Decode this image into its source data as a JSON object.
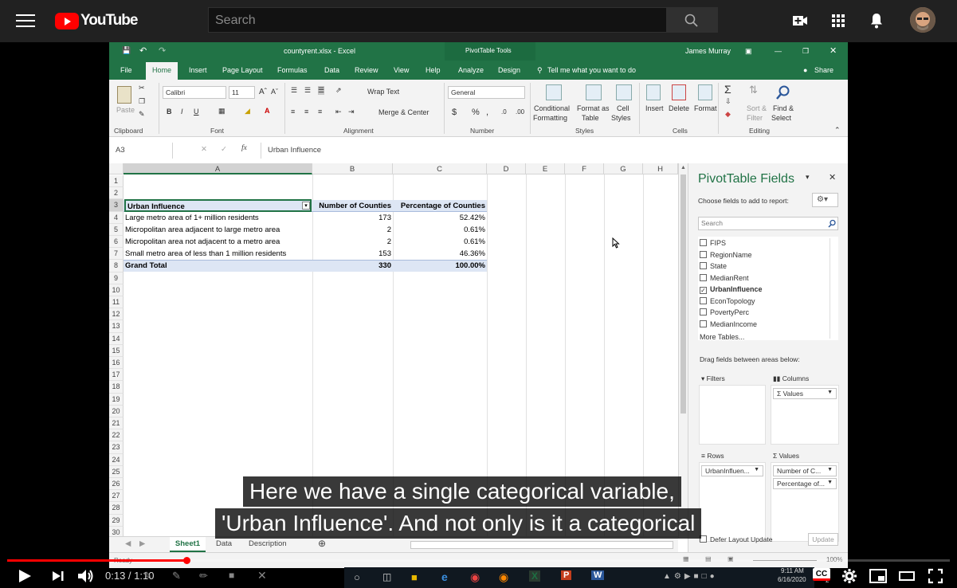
{
  "youtube": {
    "logo_text": "YouTube",
    "search_placeholder": "Search"
  },
  "excel": {
    "filename": "countyrent.xlsx  -  Excel",
    "pivot_tools": "PivotTable Tools",
    "user": "James Murray",
    "tabs": [
      "File",
      "Home",
      "Insert",
      "Page Layout",
      "Formulas",
      "Data",
      "Review",
      "View",
      "Help",
      "Analyze",
      "Design"
    ],
    "tell_me": "Tell me what you want to do",
    "share": "Share",
    "ribbon": {
      "paste": "Paste",
      "font_name": "Calibri",
      "font_size": "11",
      "wrap_text": "Wrap Text",
      "merge_center": "Merge & Center",
      "number_format": "General",
      "conditional": "Conditional",
      "formatting": "Formatting",
      "format_as": "Format as",
      "table": "Table",
      "cell": "Cell",
      "styles": "Styles",
      "insert": "Insert",
      "delete": "Delete",
      "format": "Format",
      "sort_filter": "Sort &",
      "filter": "Filter",
      "find_select": "Find &",
      "select": "Select",
      "groups": [
        "Clipboard",
        "Font",
        "Alignment",
        "Number",
        "Styles",
        "Cells",
        "Editing"
      ]
    },
    "name_box": "A3",
    "formula": "Urban Influence",
    "columns": [
      "A",
      "B",
      "C",
      "D",
      "E",
      "F",
      "G",
      "H"
    ],
    "rows": [
      "1",
      "2",
      "3",
      "4",
      "5",
      "6",
      "7",
      "8",
      "9",
      "10",
      "11",
      "12",
      "13",
      "14",
      "15",
      "16",
      "17",
      "18",
      "19",
      "20",
      "21",
      "22",
      "23",
      "24",
      "25",
      "26",
      "27",
      "28",
      "29",
      "30"
    ],
    "pivot": {
      "headers": [
        "Urban Influence",
        "Number of Counties",
        "Percentage of Counties"
      ],
      "rows": [
        [
          "Large metro area of 1+ million residents",
          "173",
          "52.42%"
        ],
        [
          "Micropolitan area adjacent to large metro area",
          "2",
          "0.61%"
        ],
        [
          "Micropolitan area not adjacent to a metro area",
          "2",
          "0.61%"
        ],
        [
          "Small metro area of less than 1 million residents",
          "153",
          "46.36%"
        ]
      ],
      "total": [
        "Grand Total",
        "330",
        "100.00%"
      ]
    },
    "sheets": [
      "Sheet1",
      "Data",
      "Description"
    ],
    "status": "Ready",
    "zoom": "100%"
  },
  "pivot_fields": {
    "title": "PivotTable Fields",
    "choose": "Choose fields to add to report:",
    "search": "Search",
    "fields": [
      {
        "name": "FIPS",
        "checked": false
      },
      {
        "name": "RegionName",
        "checked": false
      },
      {
        "name": "State",
        "checked": false
      },
      {
        "name": "MedianRent",
        "checked": false
      },
      {
        "name": "UrbanInfluence",
        "checked": true
      },
      {
        "name": "EconTopology",
        "checked": false
      },
      {
        "name": "PovertyPerc",
        "checked": false
      },
      {
        "name": "MedianIncome",
        "checked": false
      }
    ],
    "more_tables": "More Tables...",
    "drag": "Drag fields between areas below:",
    "filters": "Filters",
    "columns": "Columns",
    "columns_pill": "Values",
    "rows": "Rows",
    "rows_pill": "UrbanInfluen...",
    "values": "Values",
    "values_pills": [
      "Number of C...",
      "Percentage of..."
    ],
    "defer": "Defer Layout Update",
    "update": "Update"
  },
  "captions": [
    "Here we have a single categorical variable,",
    "'Urban Influence'. And not only is it a categorical"
  ],
  "player": {
    "time": "0:13 / 1:10",
    "progress": 0.19
  },
  "taskbar": {
    "clock_time": "9:11 AM",
    "clock_date": "6/16/2020",
    "badge": "2"
  }
}
